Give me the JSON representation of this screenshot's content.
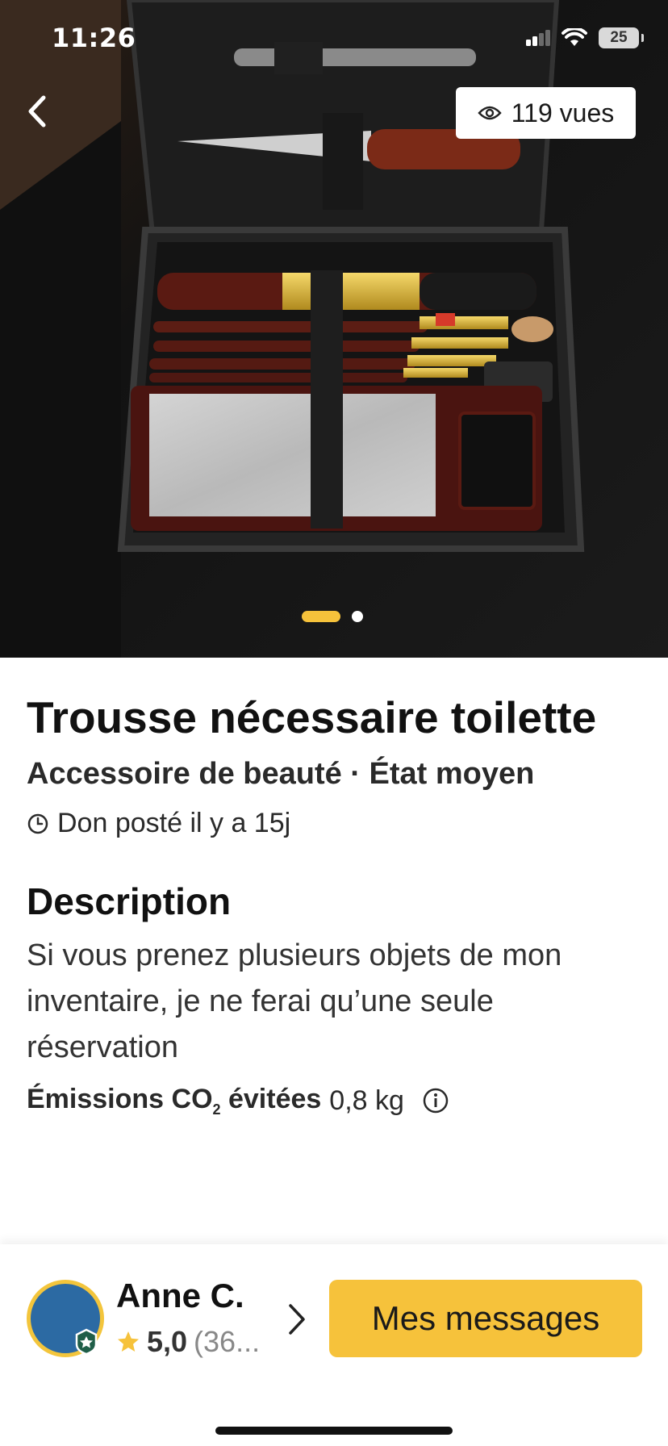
{
  "status_bar": {
    "time": "11:26",
    "battery": "25"
  },
  "hero": {
    "views_label": "119 vues",
    "image_count": 2,
    "active_index": 0
  },
  "listing": {
    "title": "Trousse nécessaire toilette",
    "subtitle": "Accessoire de beauté · État moyen",
    "posted": "Don posté il y a 15j",
    "description_heading": "Description",
    "description": "Si vous prenez plusieurs objets de mon inventaire, je ne ferai qu’une seule réservation",
    "co2_label_prefix": "Émissions CO",
    "co2_subscript": "2",
    "co2_label_suffix": " évitées",
    "co2_value": "0,8 kg"
  },
  "giver": {
    "name": "Anne C.",
    "rating": "5,0",
    "reviews": "(36..."
  },
  "actions": {
    "messages_button": "Mes messages"
  },
  "colors": {
    "accent": "#f6c23b",
    "avatar": "#2c6aa3"
  },
  "icons": [
    "back-arrow-icon",
    "eye-icon",
    "clock-icon",
    "info-icon",
    "star-icon",
    "chevron-right-icon",
    "signal-icon",
    "wifi-icon",
    "battery-icon",
    "verified-badge-icon"
  ]
}
